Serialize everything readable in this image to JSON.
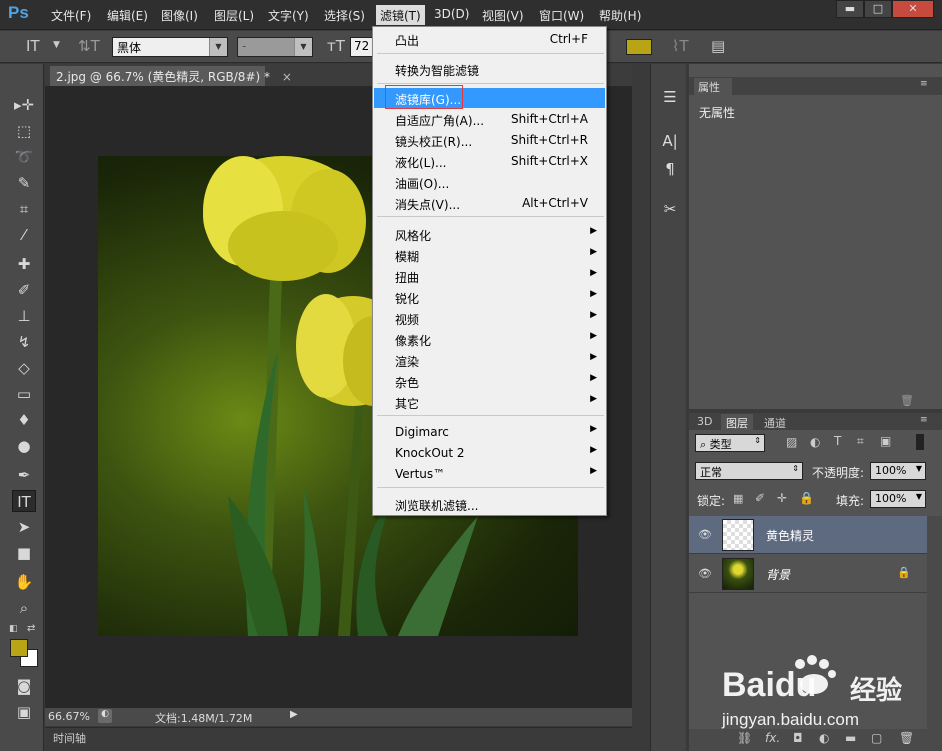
{
  "menubar": {
    "logo": "Ps",
    "items": [
      "文件(F)",
      "编辑(E)",
      "图像(I)",
      "图层(L)",
      "文字(Y)",
      "选择(S)",
      "滤镜(T)",
      "3D(D)",
      "视图(V)",
      "窗口(W)",
      "帮助(H)"
    ]
  },
  "options": {
    "font_family": "黑体",
    "font_style": "-",
    "font_size": "72"
  },
  "document": {
    "tab_title": "2.jpg @ 66.7% (黄色精灵, RGB/8#) *",
    "zoom": "66.67%",
    "doc_info": "文档:1.48M/1.72M",
    "timeline_label": "时间轴"
  },
  "filter_menu": {
    "groups": [
      [
        {
          "label": "凸出",
          "shortcut": "Ctrl+F"
        }
      ],
      [
        {
          "label": "转换为智能滤镜"
        }
      ],
      [
        {
          "label": "滤镜库(G)...",
          "highlighted": true
        },
        {
          "label": "自适应广角(A)...",
          "shortcut": "Shift+Ctrl+A"
        },
        {
          "label": "镜头校正(R)...",
          "shortcut": "Shift+Ctrl+R"
        },
        {
          "label": "液化(L)...",
          "shortcut": "Shift+Ctrl+X"
        },
        {
          "label": "油画(O)..."
        },
        {
          "label": "消失点(V)...",
          "shortcut": "Alt+Ctrl+V"
        }
      ],
      [
        {
          "label": "风格化",
          "submenu": true
        },
        {
          "label": "模糊",
          "submenu": true
        },
        {
          "label": "扭曲",
          "submenu": true
        },
        {
          "label": "锐化",
          "submenu": true
        },
        {
          "label": "视频",
          "submenu": true
        },
        {
          "label": "像素化",
          "submenu": true
        },
        {
          "label": "渲染",
          "submenu": true
        },
        {
          "label": "杂色",
          "submenu": true
        },
        {
          "label": "其它",
          "submenu": true
        }
      ],
      [
        {
          "label": "Digimarc",
          "submenu": true
        },
        {
          "label": "KnockOut 2",
          "submenu": true
        },
        {
          "label": "Vertus™",
          "submenu": true
        }
      ],
      [
        {
          "label": "浏览联机滤镜..."
        }
      ]
    ]
  },
  "properties": {
    "tab": "属性",
    "empty_text": "无属性"
  },
  "layers": {
    "tabs": [
      "3D",
      "图层",
      "通道"
    ],
    "filter_kind": "类型",
    "blend_mode": "正常",
    "opacity_label": "不透明度:",
    "opacity": "100%",
    "lock_label": "锁定:",
    "fill_label": "填充:",
    "fill": "100%",
    "items": [
      {
        "name": "黄色精灵",
        "selected": true
      },
      {
        "name": "背景",
        "locked": true
      }
    ]
  },
  "colors": {
    "foreground": "#b8a414",
    "background": "#ffffff",
    "menu_highlight": "#3399ff",
    "ps_logo": "#4da3e8",
    "selected_layer": "#5d6a80"
  },
  "watermark": {
    "brand": "Baidu",
    "sub": "经验",
    "url": "jingyan.baidu.com"
  }
}
